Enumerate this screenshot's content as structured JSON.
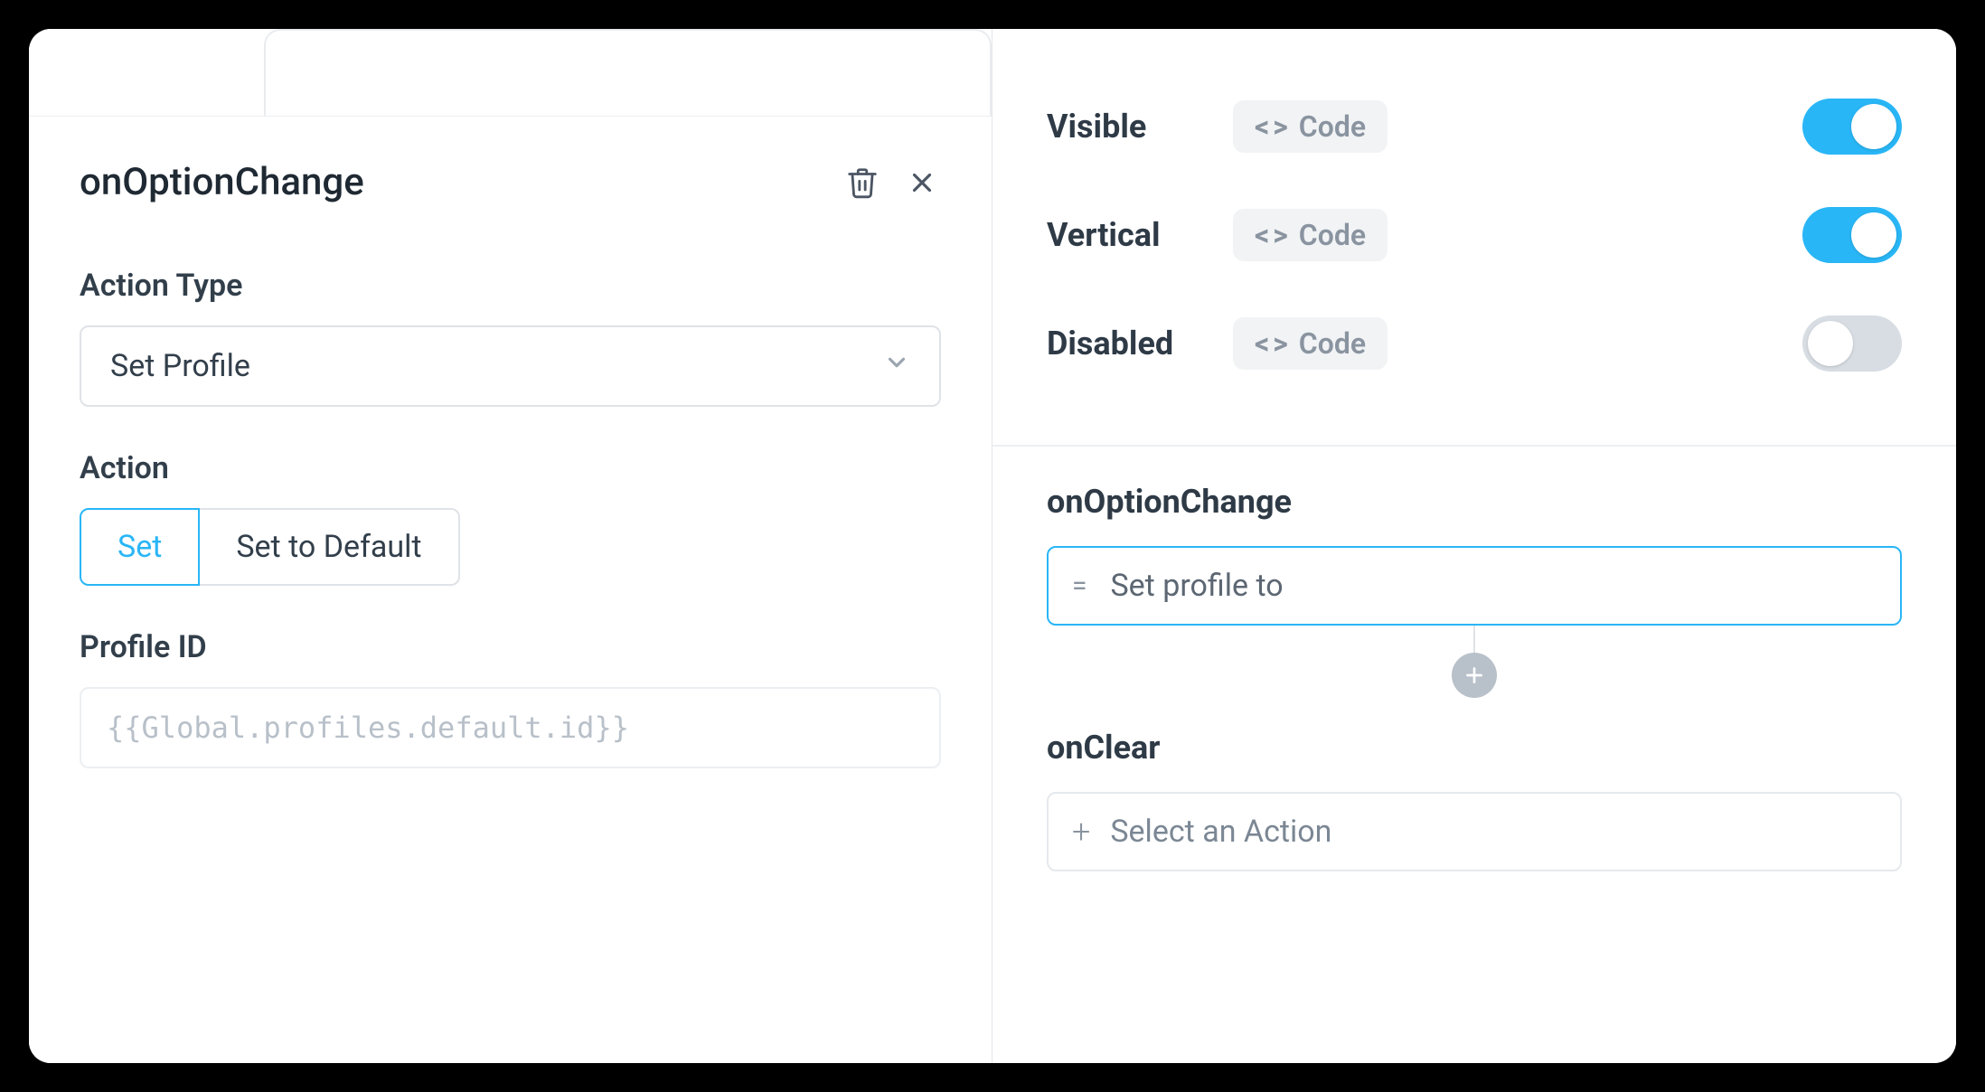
{
  "leftPanel": {
    "title": "onOptionChange",
    "actionTypeLabel": "Action Type",
    "actionTypeValue": "Set Profile",
    "actionLabel": "Action",
    "actionOptions": {
      "set": "Set",
      "setDefault": "Set to Default"
    },
    "profileIdLabel": "Profile ID",
    "profileIdPlaceholder": "{{Global.profiles.default.id}}"
  },
  "rightPanel": {
    "props": [
      {
        "name": "Visible",
        "chip": "Code",
        "on": true
      },
      {
        "name": "Vertical",
        "chip": "Code",
        "on": true
      },
      {
        "name": "Disabled",
        "chip": "Code",
        "on": false
      }
    ],
    "events": {
      "onOptionChange": {
        "title": "onOptionChange",
        "actionText": "Set profile to"
      },
      "onClear": {
        "title": "onClear",
        "placeholder": "Select an Action"
      }
    }
  }
}
